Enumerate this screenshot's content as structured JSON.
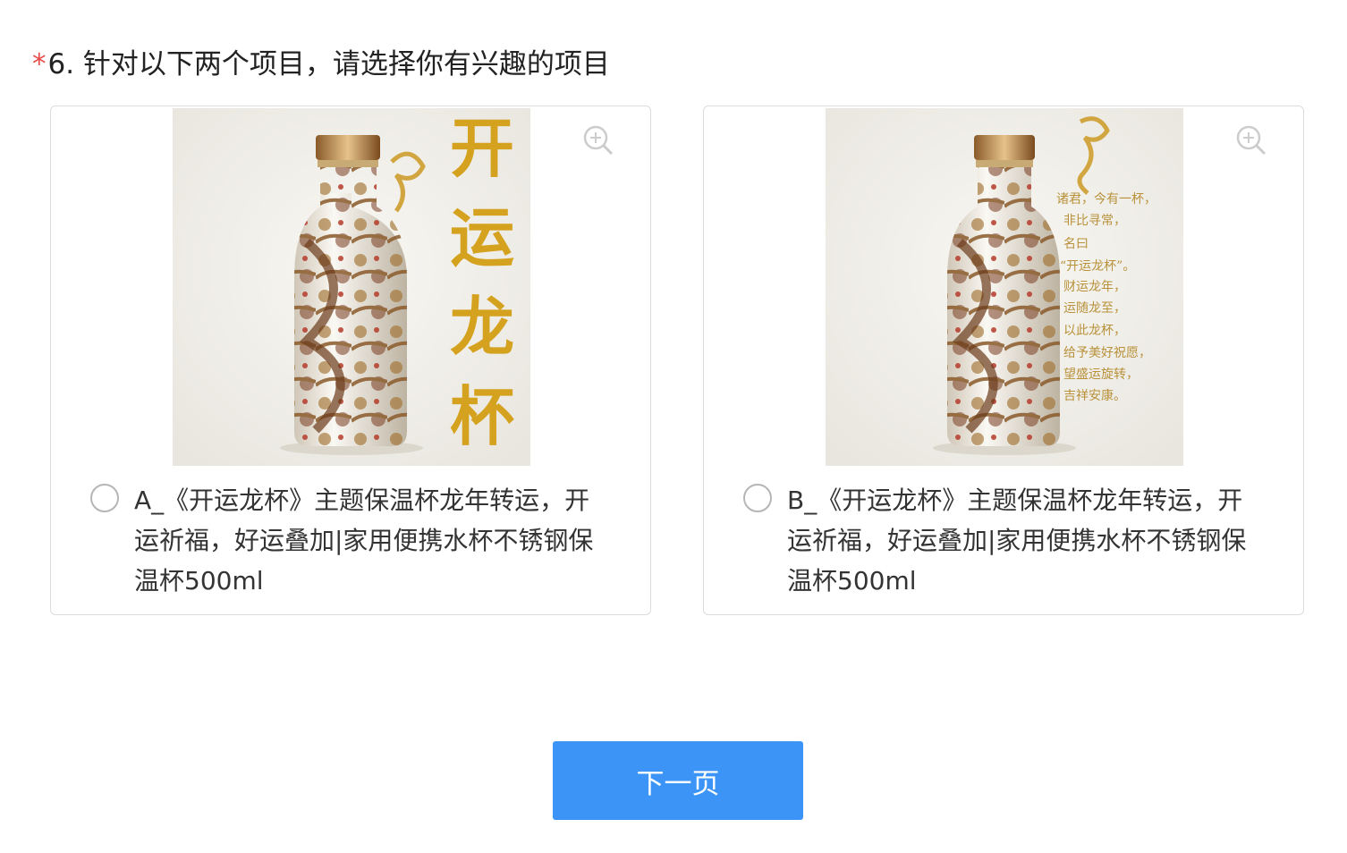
{
  "question": {
    "required_mark": "*",
    "text": "6. 针对以下两个项目，请选择你有兴趣的项目"
  },
  "options": [
    {
      "label": "A_《开运龙杯》主题保温杯龙年转运，开运祈福，好运叠加|家用便携水杯不锈钢保温杯500ml",
      "image_title": "开运龙杯",
      "zoom_icon": "zoom-in-icon"
    },
    {
      "label": "B_《开运龙杯》主题保温杯龙年转运，开运祈福，好运叠加|家用便携水杯不锈钢保温杯500ml",
      "image_poem": [
        "诸君，今有一杯，",
        "非比寻常，",
        "名曰",
        "“开运龙杯”。",
        "财运龙年，",
        "运随龙至，",
        "以此龙杯，",
        "给予美好祝愿，",
        "望盛运旋转，",
        "吉祥安康。"
      ],
      "zoom_icon": "zoom-in-icon"
    }
  ],
  "next_button": "下一页",
  "colors": {
    "required": "#e84a4a",
    "button_bg": "#3c95f6",
    "gold": "#d4a21e"
  }
}
